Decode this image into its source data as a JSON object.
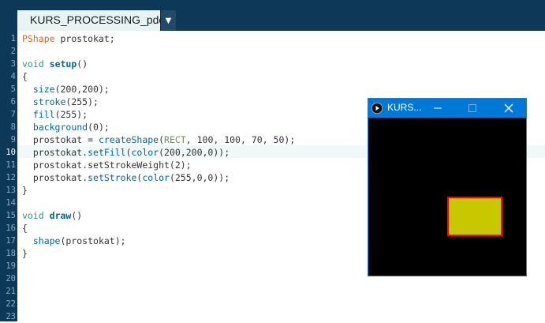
{
  "tab": {
    "label": "KURS_PROCESSING_pde",
    "menu_glyph": "▼"
  },
  "editor": {
    "line_numbers": [
      "1",
      "2",
      "3",
      "4",
      "5",
      "6",
      "7",
      "8",
      "9",
      "10",
      "11",
      "12",
      "13",
      "14",
      "15",
      "16",
      "17",
      "18",
      "19",
      "20",
      "21",
      "22",
      "23"
    ],
    "highlighted_line": 10
  },
  "code": {
    "l1": [
      "PShape",
      " prostokat;"
    ],
    "l3": [
      "void",
      " ",
      "setup",
      "()"
    ],
    "l4": "{",
    "l5": [
      "  ",
      "size",
      "(200,200);"
    ],
    "l6": [
      "  ",
      "stroke",
      "(255);"
    ],
    "l7": [
      "  ",
      "fill",
      "(255);"
    ],
    "l8": [
      "  ",
      "background",
      "(0);"
    ],
    "l9": [
      "  prostokat = ",
      "createShape",
      "(",
      "RECT",
      ", 100, 100, 70, 50);"
    ],
    "l10": [
      "  prostokat.",
      "setFill",
      "(",
      "color",
      "(200,200,0));"
    ],
    "l11": "  prostokat.setStrokeWeight(2);",
    "l12": [
      "  prostokat.",
      "setStroke",
      "(",
      "color",
      "(255,0,0));"
    ],
    "l13": "}",
    "l15": [
      "void",
      " ",
      "draw",
      "()"
    ],
    "l16": "{",
    "l17": [
      "  ",
      "shape",
      "(prostokat);"
    ],
    "l18": "}"
  },
  "sketch_window": {
    "title": "KURS...",
    "minimize_glyph": "—",
    "maximize_glyph": "☐",
    "close_glyph": "✕",
    "icon": "processing-play-icon",
    "canvas_bg": "#000000",
    "shape_fill": "#c8c800",
    "shape_stroke": "#ff0000"
  },
  "colors": {
    "chrome": "#0d3858",
    "titlebar": "#0078d7",
    "type": "#e2661a",
    "keyword": "#33997e",
    "function": "#006699"
  }
}
